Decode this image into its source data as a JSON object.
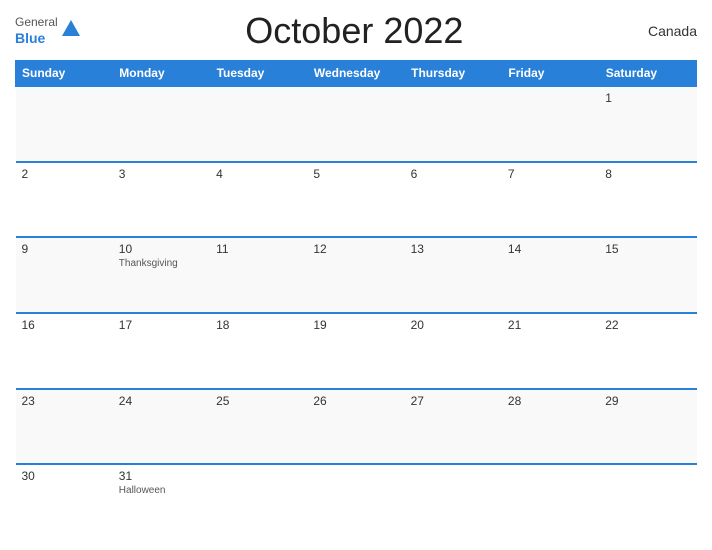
{
  "header": {
    "title": "October 2022",
    "country": "Canada",
    "logo": {
      "general": "General",
      "blue": "Blue"
    }
  },
  "weekdays": [
    "Sunday",
    "Monday",
    "Tuesday",
    "Wednesday",
    "Thursday",
    "Friday",
    "Saturday"
  ],
  "weeks": [
    [
      {
        "day": "",
        "empty": true
      },
      {
        "day": "",
        "empty": true
      },
      {
        "day": "",
        "empty": true
      },
      {
        "day": "",
        "empty": true
      },
      {
        "day": "",
        "empty": true
      },
      {
        "day": "",
        "empty": true
      },
      {
        "day": "1",
        "event": ""
      }
    ],
    [
      {
        "day": "2",
        "event": ""
      },
      {
        "day": "3",
        "event": ""
      },
      {
        "day": "4",
        "event": ""
      },
      {
        "day": "5",
        "event": ""
      },
      {
        "day": "6",
        "event": ""
      },
      {
        "day": "7",
        "event": ""
      },
      {
        "day": "8",
        "event": ""
      }
    ],
    [
      {
        "day": "9",
        "event": ""
      },
      {
        "day": "10",
        "event": "Thanksgiving"
      },
      {
        "day": "11",
        "event": ""
      },
      {
        "day": "12",
        "event": ""
      },
      {
        "day": "13",
        "event": ""
      },
      {
        "day": "14",
        "event": ""
      },
      {
        "day": "15",
        "event": ""
      }
    ],
    [
      {
        "day": "16",
        "event": ""
      },
      {
        "day": "17",
        "event": ""
      },
      {
        "day": "18",
        "event": ""
      },
      {
        "day": "19",
        "event": ""
      },
      {
        "day": "20",
        "event": ""
      },
      {
        "day": "21",
        "event": ""
      },
      {
        "day": "22",
        "event": ""
      }
    ],
    [
      {
        "day": "23",
        "event": ""
      },
      {
        "day": "24",
        "event": ""
      },
      {
        "day": "25",
        "event": ""
      },
      {
        "day": "26",
        "event": ""
      },
      {
        "day": "27",
        "event": ""
      },
      {
        "day": "28",
        "event": ""
      },
      {
        "day": "29",
        "event": ""
      }
    ],
    [
      {
        "day": "30",
        "event": ""
      },
      {
        "day": "31",
        "event": "Halloween"
      },
      {
        "day": "",
        "empty": true
      },
      {
        "day": "",
        "empty": true
      },
      {
        "day": "",
        "empty": true
      },
      {
        "day": "",
        "empty": true
      },
      {
        "day": "",
        "empty": true
      }
    ]
  ]
}
